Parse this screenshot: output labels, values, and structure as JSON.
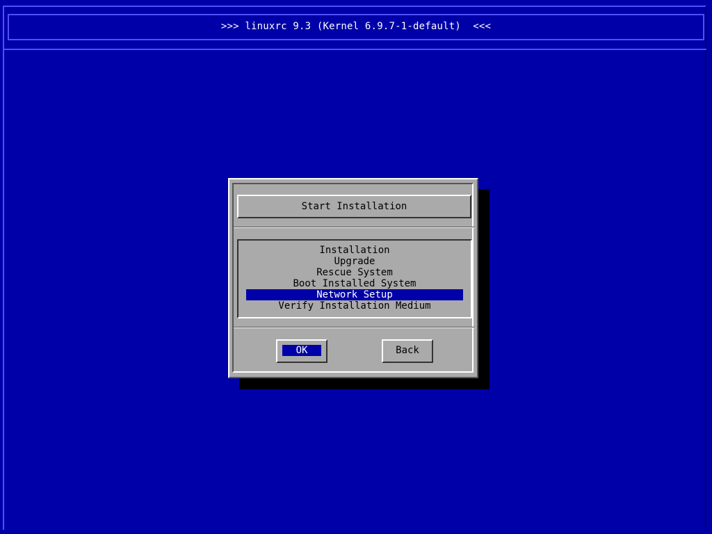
{
  "header": {
    "title": ">>> linuxrc 9.3 (Kernel 6.9.7-1-default)  <<<"
  },
  "dialog": {
    "title": "Start Installation",
    "items": [
      {
        "label": "Installation"
      },
      {
        "label": "Upgrade"
      },
      {
        "label": "Rescue System"
      },
      {
        "label": "Boot Installed System"
      },
      {
        "label": "Network Setup",
        "selected": true
      },
      {
        "label": "Verify Installation Medium"
      }
    ],
    "ok_label": "OK",
    "back_label": "Back"
  },
  "colors": {
    "background": "#0000a8",
    "dialog": "#aaaaaa",
    "highlight": "#0000a8"
  }
}
